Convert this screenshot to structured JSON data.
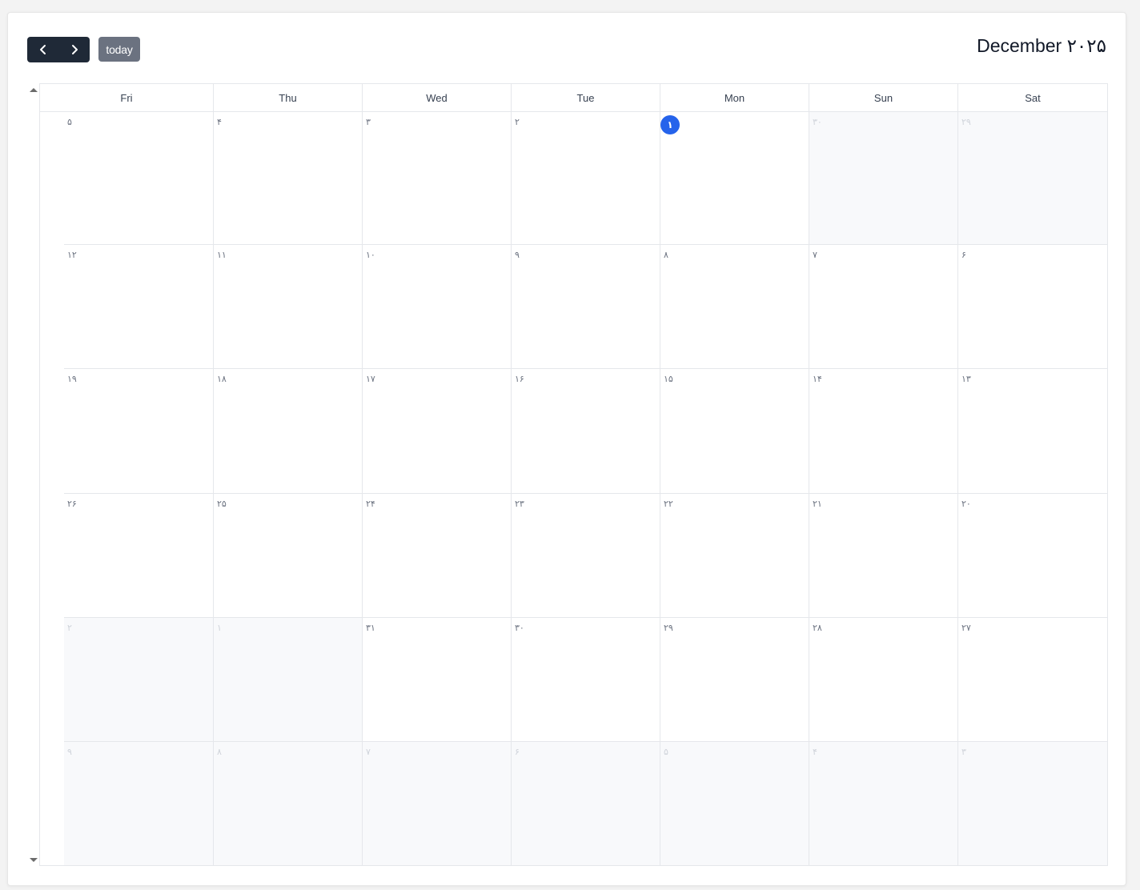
{
  "toolbar": {
    "prev_label": "",
    "next_label": "",
    "today_label": "today",
    "title": "December ۲۰۲۵"
  },
  "calendar": {
    "weekdays": [
      "Fri",
      "Thu",
      "Wed",
      "Tue",
      "Mon",
      "Sun",
      "Sat"
    ],
    "weeks": [
      [
        {
          "label": "۵",
          "other": false
        },
        {
          "label": "۴",
          "other": false
        },
        {
          "label": "۳",
          "other": false
        },
        {
          "label": "۲",
          "other": false
        },
        {
          "label": "۱",
          "other": false,
          "today": true
        },
        {
          "label": "۳۰",
          "other": true
        },
        {
          "label": "۲۹",
          "other": true
        }
      ],
      [
        {
          "label": "۱۲",
          "other": false
        },
        {
          "label": "۱۱",
          "other": false
        },
        {
          "label": "۱۰",
          "other": false
        },
        {
          "label": "۹",
          "other": false
        },
        {
          "label": "۸",
          "other": false
        },
        {
          "label": "۷",
          "other": false
        },
        {
          "label": "۶",
          "other": false
        }
      ],
      [
        {
          "label": "۱۹",
          "other": false
        },
        {
          "label": "۱۸",
          "other": false
        },
        {
          "label": "۱۷",
          "other": false
        },
        {
          "label": "۱۶",
          "other": false
        },
        {
          "label": "۱۵",
          "other": false
        },
        {
          "label": "۱۴",
          "other": false
        },
        {
          "label": "۱۳",
          "other": false
        }
      ],
      [
        {
          "label": "۲۶",
          "other": false
        },
        {
          "label": "۲۵",
          "other": false
        },
        {
          "label": "۲۴",
          "other": false
        },
        {
          "label": "۲۳",
          "other": false
        },
        {
          "label": "۲۲",
          "other": false
        },
        {
          "label": "۲۱",
          "other": false
        },
        {
          "label": "۲۰",
          "other": false
        }
      ],
      [
        {
          "label": "۲",
          "other": true
        },
        {
          "label": "۱",
          "other": true
        },
        {
          "label": "۳۱",
          "other": false
        },
        {
          "label": "۳۰",
          "other": false
        },
        {
          "label": "۲۹",
          "other": false
        },
        {
          "label": "۲۸",
          "other": false
        },
        {
          "label": "۲۷",
          "other": false
        }
      ],
      [
        {
          "label": "۹",
          "other": true
        },
        {
          "label": "۸",
          "other": true
        },
        {
          "label": "۷",
          "other": true
        },
        {
          "label": "۶",
          "other": true
        },
        {
          "label": "۵",
          "other": true
        },
        {
          "label": "۴",
          "other": true
        },
        {
          "label": "۳",
          "other": true
        }
      ]
    ]
  },
  "colors": {
    "nav_bg": "#1f2937",
    "today_button_bg": "#6b7280",
    "today_highlight": "#2563eb",
    "other_month_bg": "#f8f9fb"
  },
  "icons": {
    "prev": "chevron-left-icon",
    "next": "chevron-right-icon",
    "scroll_up": "scroll-up-arrow-icon",
    "scroll_down": "scroll-down-arrow-icon"
  }
}
